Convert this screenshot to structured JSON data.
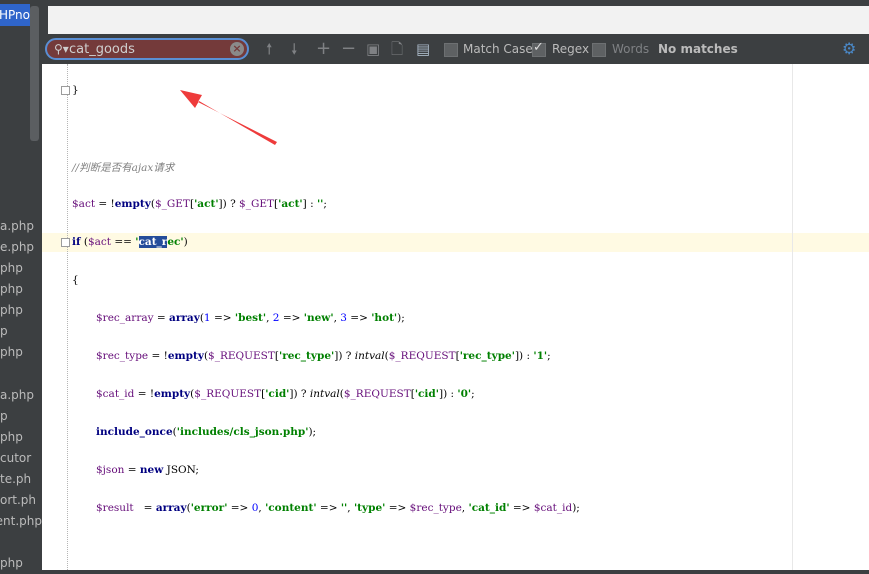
{
  "sidebar": {
    "top_tab": "HPno",
    "files": [
      "a.php",
      "e.php",
      "php",
      "php",
      "php",
      "p",
      "php",
      "a.php",
      "p",
      "php",
      "cutor",
      "te.ph",
      "ort.ph",
      "ent.php",
      "php"
    ]
  },
  "find": {
    "query": "cat_goods",
    "match_case_label": "Match Case",
    "match_case_checked": false,
    "regex_label": "Regex",
    "regex_checked": true,
    "words_label": "Words",
    "words_checked": false,
    "status": "No matches"
  },
  "code": {
    "line1": "}",
    "comment": "//判断是否有ajax请求",
    "act": {
      "v1": "$act",
      "t1": " = !",
      "k1": "empty",
      "t2": "(",
      "v2": "$_GET",
      "t3": "[",
      "s1": "'act'",
      "t4": "]) ? ",
      "v3": "$_GET",
      "t5": "[",
      "s2": "'act'",
      "t6": "] : ",
      "s3": "''",
      "t7": ";"
    },
    "if": {
      "k": "if",
      "t1": " (",
      "v": "$act",
      "t2": " == ",
      "s_open": "'",
      "match": "cat_r",
      "s_rest": "ec'",
      "t3": ")"
    },
    "brace": "{",
    "rec_array": {
      "v": "$rec_array",
      "t1": " = ",
      "k": "array",
      "t2": "(",
      "n1": "1",
      "t3": " => ",
      "s1": "'best'",
      "t4": ", ",
      "n2": "2",
      "t5": " => ",
      "s2": "'new'",
      "t6": ", ",
      "n3": "3",
      "t7": " => ",
      "s3": "'hot'",
      "t8": ");"
    },
    "rec_type": {
      "v1": "$rec_type",
      "t1": " = !",
      "k": "empty",
      "t2": "(",
      "v2": "$_REQUEST",
      "t3": "[",
      "s1": "'rec_type'",
      "t4": "]) ? ",
      "f": "intval",
      "t5": "(",
      "v3": "$_REQUEST",
      "t6": "[",
      "s2": "'rec_type'",
      "t7": "]) : ",
      "s3": "'1'",
      "t8": ";"
    },
    "cat_id": {
      "v1": "$cat_id",
      "t1": " = !",
      "k": "empty",
      "t2": "(",
      "v2": "$_REQUEST",
      "t3": "[",
      "s1": "'cid'",
      "t4": "]) ? ",
      "f": "intval",
      "t5": "(",
      "v3": "$_REQUEST",
      "t6": "[",
      "s2": "'cid'",
      "t7": "]) : ",
      "s3": "'0'",
      "t8": ";"
    },
    "include": {
      "k": "include_once",
      "t1": "(",
      "s": "'includes/cls_json.php'",
      "t2": ");"
    },
    "json": {
      "v": "$json",
      "t1": " = ",
      "k": "new",
      "t2": " JSON;"
    },
    "result": {
      "v1": "$result",
      "t1": "   = ",
      "k": "array",
      "t2": "(",
      "s1": "'error'",
      "t3": " => ",
      "n": "0",
      "t4": ", ",
      "s2": "'content'",
      "t5": " => ",
      "s3": "''",
      "t6": ", ",
      "s4": "'type'",
      "t7": " => ",
      "v2": "$rec_type",
      "t8": ", ",
      "s5": "'cat_id'",
      "t9": " => ",
      "v3": "$cat_id",
      "t10": ");"
    }
  },
  "colors": {
    "annotation_arrow": "#ee3b3b",
    "search_bg": "#743a3a",
    "search_border": "#5a8fd4"
  },
  "icons": [
    "search-icon",
    "clear-icon",
    "arrow-up-icon",
    "arrow-down-icon",
    "add-icon",
    "remove-icon",
    "select-all-icon",
    "export-icon",
    "filter-icon",
    "settings-icon"
  ]
}
